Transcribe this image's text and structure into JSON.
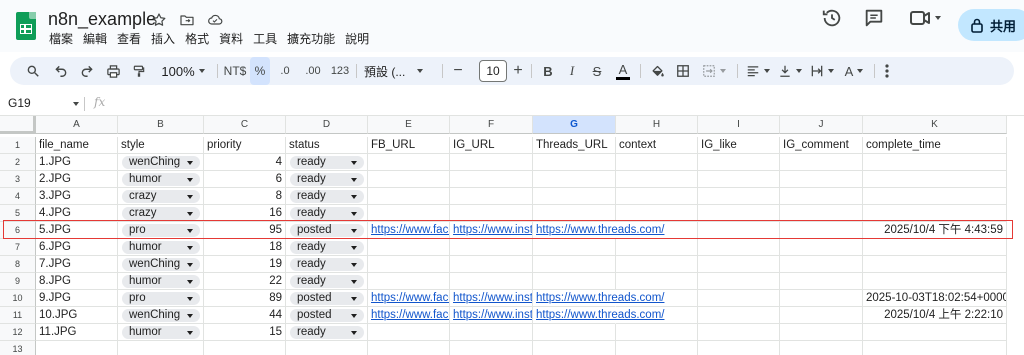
{
  "doc": {
    "title": "n8n_example"
  },
  "menu": [
    "檔案",
    "編輯",
    "查看",
    "插入",
    "格式",
    "資料",
    "工具",
    "擴充功能",
    "說明"
  ],
  "share": {
    "label": "共用"
  },
  "toolbar": {
    "zoom": "100%",
    "currency": "NT$",
    "percent": "%",
    "dec_decrease": ".0",
    "dec_increase": ".00",
    "number_format": "123",
    "font": "預設 (...",
    "font_size": "10",
    "minus": "−",
    "plus": "+"
  },
  "formula": {
    "cell_ref": "G19",
    "fx": "fx"
  },
  "columns": [
    "A",
    "B",
    "C",
    "D",
    "E",
    "F",
    "G",
    "H",
    "I",
    "J",
    "K"
  ],
  "selected_column": "G",
  "rows": [
    {
      "n": "1",
      "file_name": "file_name",
      "style": "style",
      "priority": "priority",
      "status": "status",
      "fb": "FB_URL",
      "ig": "IG_URL",
      "threads": "Threads_URL",
      "context": "context",
      "ig_like": "IG_like",
      "ig_comment": "IG_comment",
      "complete": "complete_time"
    },
    {
      "n": "2",
      "file_name": "1.JPG",
      "style": "wenChing",
      "priority": "4",
      "status": "ready",
      "fb": "",
      "ig": "",
      "threads": "",
      "context": "",
      "ig_like": "",
      "ig_comment": "",
      "complete": ""
    },
    {
      "n": "3",
      "file_name": "2.JPG",
      "style": "humor",
      "priority": "6",
      "status": "ready",
      "fb": "",
      "ig": "",
      "threads": "",
      "context": "",
      "ig_like": "",
      "ig_comment": "",
      "complete": ""
    },
    {
      "n": "4",
      "file_name": "3.JPG",
      "style": "crazy",
      "priority": "8",
      "status": "ready",
      "fb": "",
      "ig": "",
      "threads": "",
      "context": "",
      "ig_like": "",
      "ig_comment": "",
      "complete": ""
    },
    {
      "n": "5",
      "file_name": "4.JPG",
      "style": "crazy",
      "priority": "16",
      "status": "ready",
      "fb": "",
      "ig": "",
      "threads": "",
      "context": "",
      "ig_like": "",
      "ig_comment": "",
      "complete": ""
    },
    {
      "n": "6",
      "file_name": "5.JPG",
      "style": "pro",
      "priority": "95",
      "status": "posted",
      "fb": "https://www.face",
      "ig": "https://www.insta",
      "threads": "https://www.threads.com/",
      "context": "",
      "ig_like": "",
      "ig_comment": "",
      "complete": "2025/10/4 下午 4:43:59"
    },
    {
      "n": "7",
      "file_name": "6.JPG",
      "style": "humor",
      "priority": "18",
      "status": "ready",
      "fb": "",
      "ig": "",
      "threads": "",
      "context": "",
      "ig_like": "",
      "ig_comment": "",
      "complete": ""
    },
    {
      "n": "8",
      "file_name": "7.JPG",
      "style": "wenChing",
      "priority": "19",
      "status": "ready",
      "fb": "",
      "ig": "",
      "threads": "",
      "context": "",
      "ig_like": "",
      "ig_comment": "",
      "complete": ""
    },
    {
      "n": "9",
      "file_name": "8.JPG",
      "style": "humor",
      "priority": "22",
      "status": "ready",
      "fb": "",
      "ig": "",
      "threads": "",
      "context": "",
      "ig_like": "",
      "ig_comment": "",
      "complete": ""
    },
    {
      "n": "10",
      "file_name": "9.JPG",
      "style": "pro",
      "priority": "89",
      "status": "posted",
      "fb": "https://www.face",
      "ig": "https://www.insta",
      "threads": "https://www.threads.com/",
      "context": "",
      "ig_like": "",
      "ig_comment": "",
      "complete": "2025-10-03T18:02:54+0000"
    },
    {
      "n": "11",
      "file_name": "10.JPG",
      "style": "wenChing",
      "priority": "44",
      "status": "posted",
      "fb": "https://www.face",
      "ig": "https://www.insta",
      "threads": "https://www.threads.com/",
      "context": "",
      "ig_like": "",
      "ig_comment": "",
      "complete": "2025/10/4 上午 2:22:10"
    },
    {
      "n": "12",
      "file_name": "11.JPG",
      "style": "humor",
      "priority": "15",
      "status": "ready",
      "fb": "",
      "ig": "",
      "threads": "",
      "context": "",
      "ig_like": "",
      "ig_comment": "",
      "complete": ""
    },
    {
      "n": "13",
      "file_name": "",
      "style": "",
      "priority": "",
      "status": "",
      "fb": "",
      "ig": "",
      "threads": "",
      "context": "",
      "ig_like": "",
      "ig_comment": "",
      "complete": ""
    }
  ]
}
